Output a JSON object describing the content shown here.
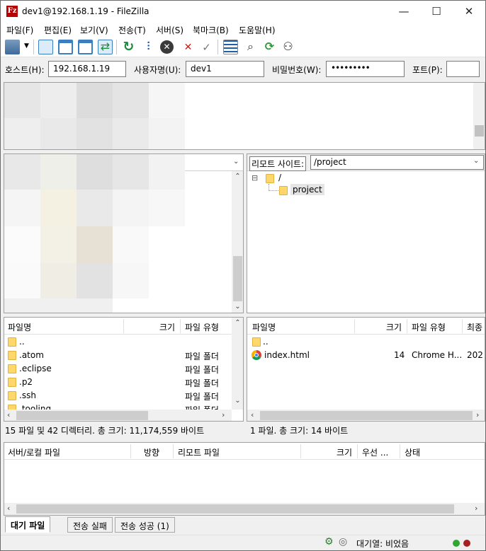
{
  "window": {
    "title": "dev1@192.168.1.19 - FileZilla",
    "app_icon_label": "Fz",
    "minimize": "—",
    "maximize": "☐",
    "close": "✕"
  },
  "menu": [
    "파일(F)",
    "편집(E)",
    "보기(V)",
    "전송(T)",
    "서버(S)",
    "북마크(B)",
    "도움말(H)"
  ],
  "toolbar": {
    "icons": [
      "site-manager-icon",
      "dropdown-icon",
      "toggle-log-icon",
      "toggle-local-tree-icon",
      "toggle-remote-tree-icon",
      "toggle-queue-icon",
      "refresh-icon",
      "process-queue-icon",
      "cancel-icon",
      "disconnect-icon",
      "reconnect-icon",
      "directory-filter-icon",
      "search-icon",
      "sync-browse-icon",
      "find-files-icon"
    ]
  },
  "quickconnect": {
    "host_label": "호스트(H):",
    "host_value": "192.168.1.19",
    "user_label": "사용자명(U):",
    "user_value": "dev1",
    "pass_label": "비밀번호(W):",
    "pass_value": "•••••••••",
    "port_label": "포트(P):",
    "port_value": ""
  },
  "remote_site": {
    "label": "리모트 사이트:",
    "path": "/project",
    "tree": [
      {
        "name": "/",
        "expand": "⊟"
      },
      {
        "name": "project"
      }
    ]
  },
  "local_list": {
    "headers": [
      "파일명",
      "크기",
      "파일 유형"
    ],
    "rows": [
      {
        "name": "..",
        "type": ""
      },
      {
        "name": ".atom",
        "type": "파일 폴더"
      },
      {
        "name": ".eclipse",
        "type": "파일 폴더"
      },
      {
        "name": ".p2",
        "type": "파일 폴더"
      },
      {
        "name": ".ssh",
        "type": "파일 폴더"
      },
      {
        "name": ".tooling",
        "type": "파일 폴더"
      }
    ],
    "status": "15 파일 및 42 디렉터리. 총 크기: 11,174,559 바이트"
  },
  "remote_list": {
    "headers": [
      "파일명",
      "크기",
      "파일 유형",
      "최종"
    ],
    "rows": [
      {
        "name": "..",
        "size": "",
        "type": "",
        "modified": ""
      },
      {
        "name": "index.html",
        "size": "14",
        "type": "Chrome H...",
        "modified": "202"
      }
    ],
    "status": "1 파일. 총 크기: 14 바이트"
  },
  "queue": {
    "headers": [
      "서버/로컬 파일",
      "방향",
      "리모트 파일",
      "크기",
      "우선 ...",
      "상태"
    ],
    "tabs": [
      "대기 파일",
      "전송 실패",
      "전송 성공 (1)"
    ]
  },
  "statusbar": {
    "queue_text": "대기열: 비었음"
  },
  "colors": {
    "accent": "#0078d7",
    "folder": "#ffd76a",
    "led_green": "#2fa82f",
    "led_red": "#a82020"
  }
}
